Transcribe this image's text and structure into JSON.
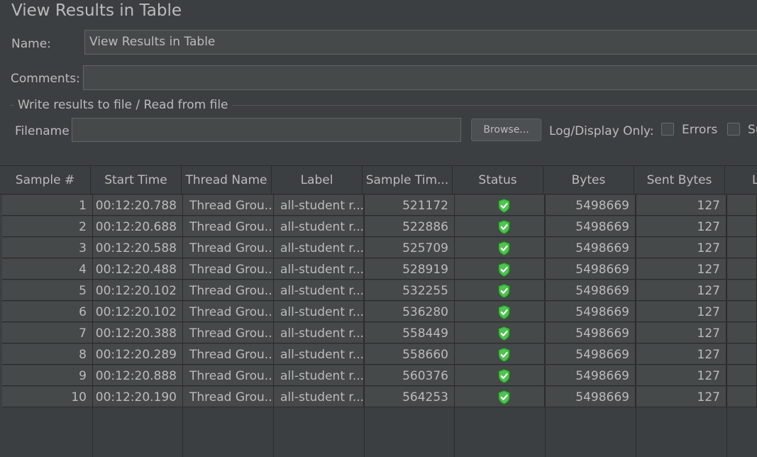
{
  "title": "View Results in Table",
  "name_label": "Name:",
  "name_value": "View Results in Table",
  "comments_label": "Comments:",
  "comments_value": "",
  "file_group_title": "Write results to file / Read from file",
  "filename_label": "Filename",
  "filename_value": "",
  "browse_label": "Browse...",
  "log_display_label": "Log/Display Only:",
  "errors_label": "Errors",
  "successes_label_partial": "Su",
  "table": {
    "columns": [
      "Sample #",
      "Start Time",
      "Thread Name",
      "Label",
      "Sample Tim...",
      "Status",
      "Bytes",
      "Sent Bytes",
      "L"
    ],
    "rows": [
      {
        "sample": "1",
        "start": "00:12:20.788",
        "thread": "Thread Grou...",
        "label": "all-student r...",
        "sample_time": "521172",
        "status": "success",
        "bytes": "5498669",
        "sent": "127"
      },
      {
        "sample": "2",
        "start": "00:12:20.688",
        "thread": "Thread Grou...",
        "label": "all-student r...",
        "sample_time": "522886",
        "status": "success",
        "bytes": "5498669",
        "sent": "127"
      },
      {
        "sample": "3",
        "start": "00:12:20.588",
        "thread": "Thread Grou...",
        "label": "all-student r...",
        "sample_time": "525709",
        "status": "success",
        "bytes": "5498669",
        "sent": "127"
      },
      {
        "sample": "4",
        "start": "00:12:20.488",
        "thread": "Thread Grou...",
        "label": "all-student r...",
        "sample_time": "528919",
        "status": "success",
        "bytes": "5498669",
        "sent": "127"
      },
      {
        "sample": "5",
        "start": "00:12:20.102",
        "thread": "Thread Grou...",
        "label": "all-student r...",
        "sample_time": "532255",
        "status": "success",
        "bytes": "5498669",
        "sent": "127"
      },
      {
        "sample": "6",
        "start": "00:12:20.102",
        "thread": "Thread Grou...",
        "label": "all-student r...",
        "sample_time": "536280",
        "status": "success",
        "bytes": "5498669",
        "sent": "127"
      },
      {
        "sample": "7",
        "start": "00:12:20.388",
        "thread": "Thread Grou...",
        "label": "all-student r...",
        "sample_time": "558449",
        "status": "success",
        "bytes": "5498669",
        "sent": "127"
      },
      {
        "sample": "8",
        "start": "00:12:20.289",
        "thread": "Thread Grou...",
        "label": "all-student r...",
        "sample_time": "558660",
        "status": "success",
        "bytes": "5498669",
        "sent": "127"
      },
      {
        "sample": "9",
        "start": "00:12:20.888",
        "thread": "Thread Grou...",
        "label": "all-student r...",
        "sample_time": "560376",
        "status": "success",
        "bytes": "5498669",
        "sent": "127"
      },
      {
        "sample": "10",
        "start": "00:12:20.190",
        "thread": "Thread Grou...",
        "label": "all-student r...",
        "sample_time": "564253",
        "status": "success",
        "bytes": "5498669",
        "sent": "127"
      }
    ]
  },
  "colors": {
    "background": "#3c3f41",
    "cell_background": "#45494a",
    "text": "#bbbbbb",
    "success_green": "#3fae3f"
  },
  "icons": {
    "status_success": "green-shield-check-icon"
  }
}
